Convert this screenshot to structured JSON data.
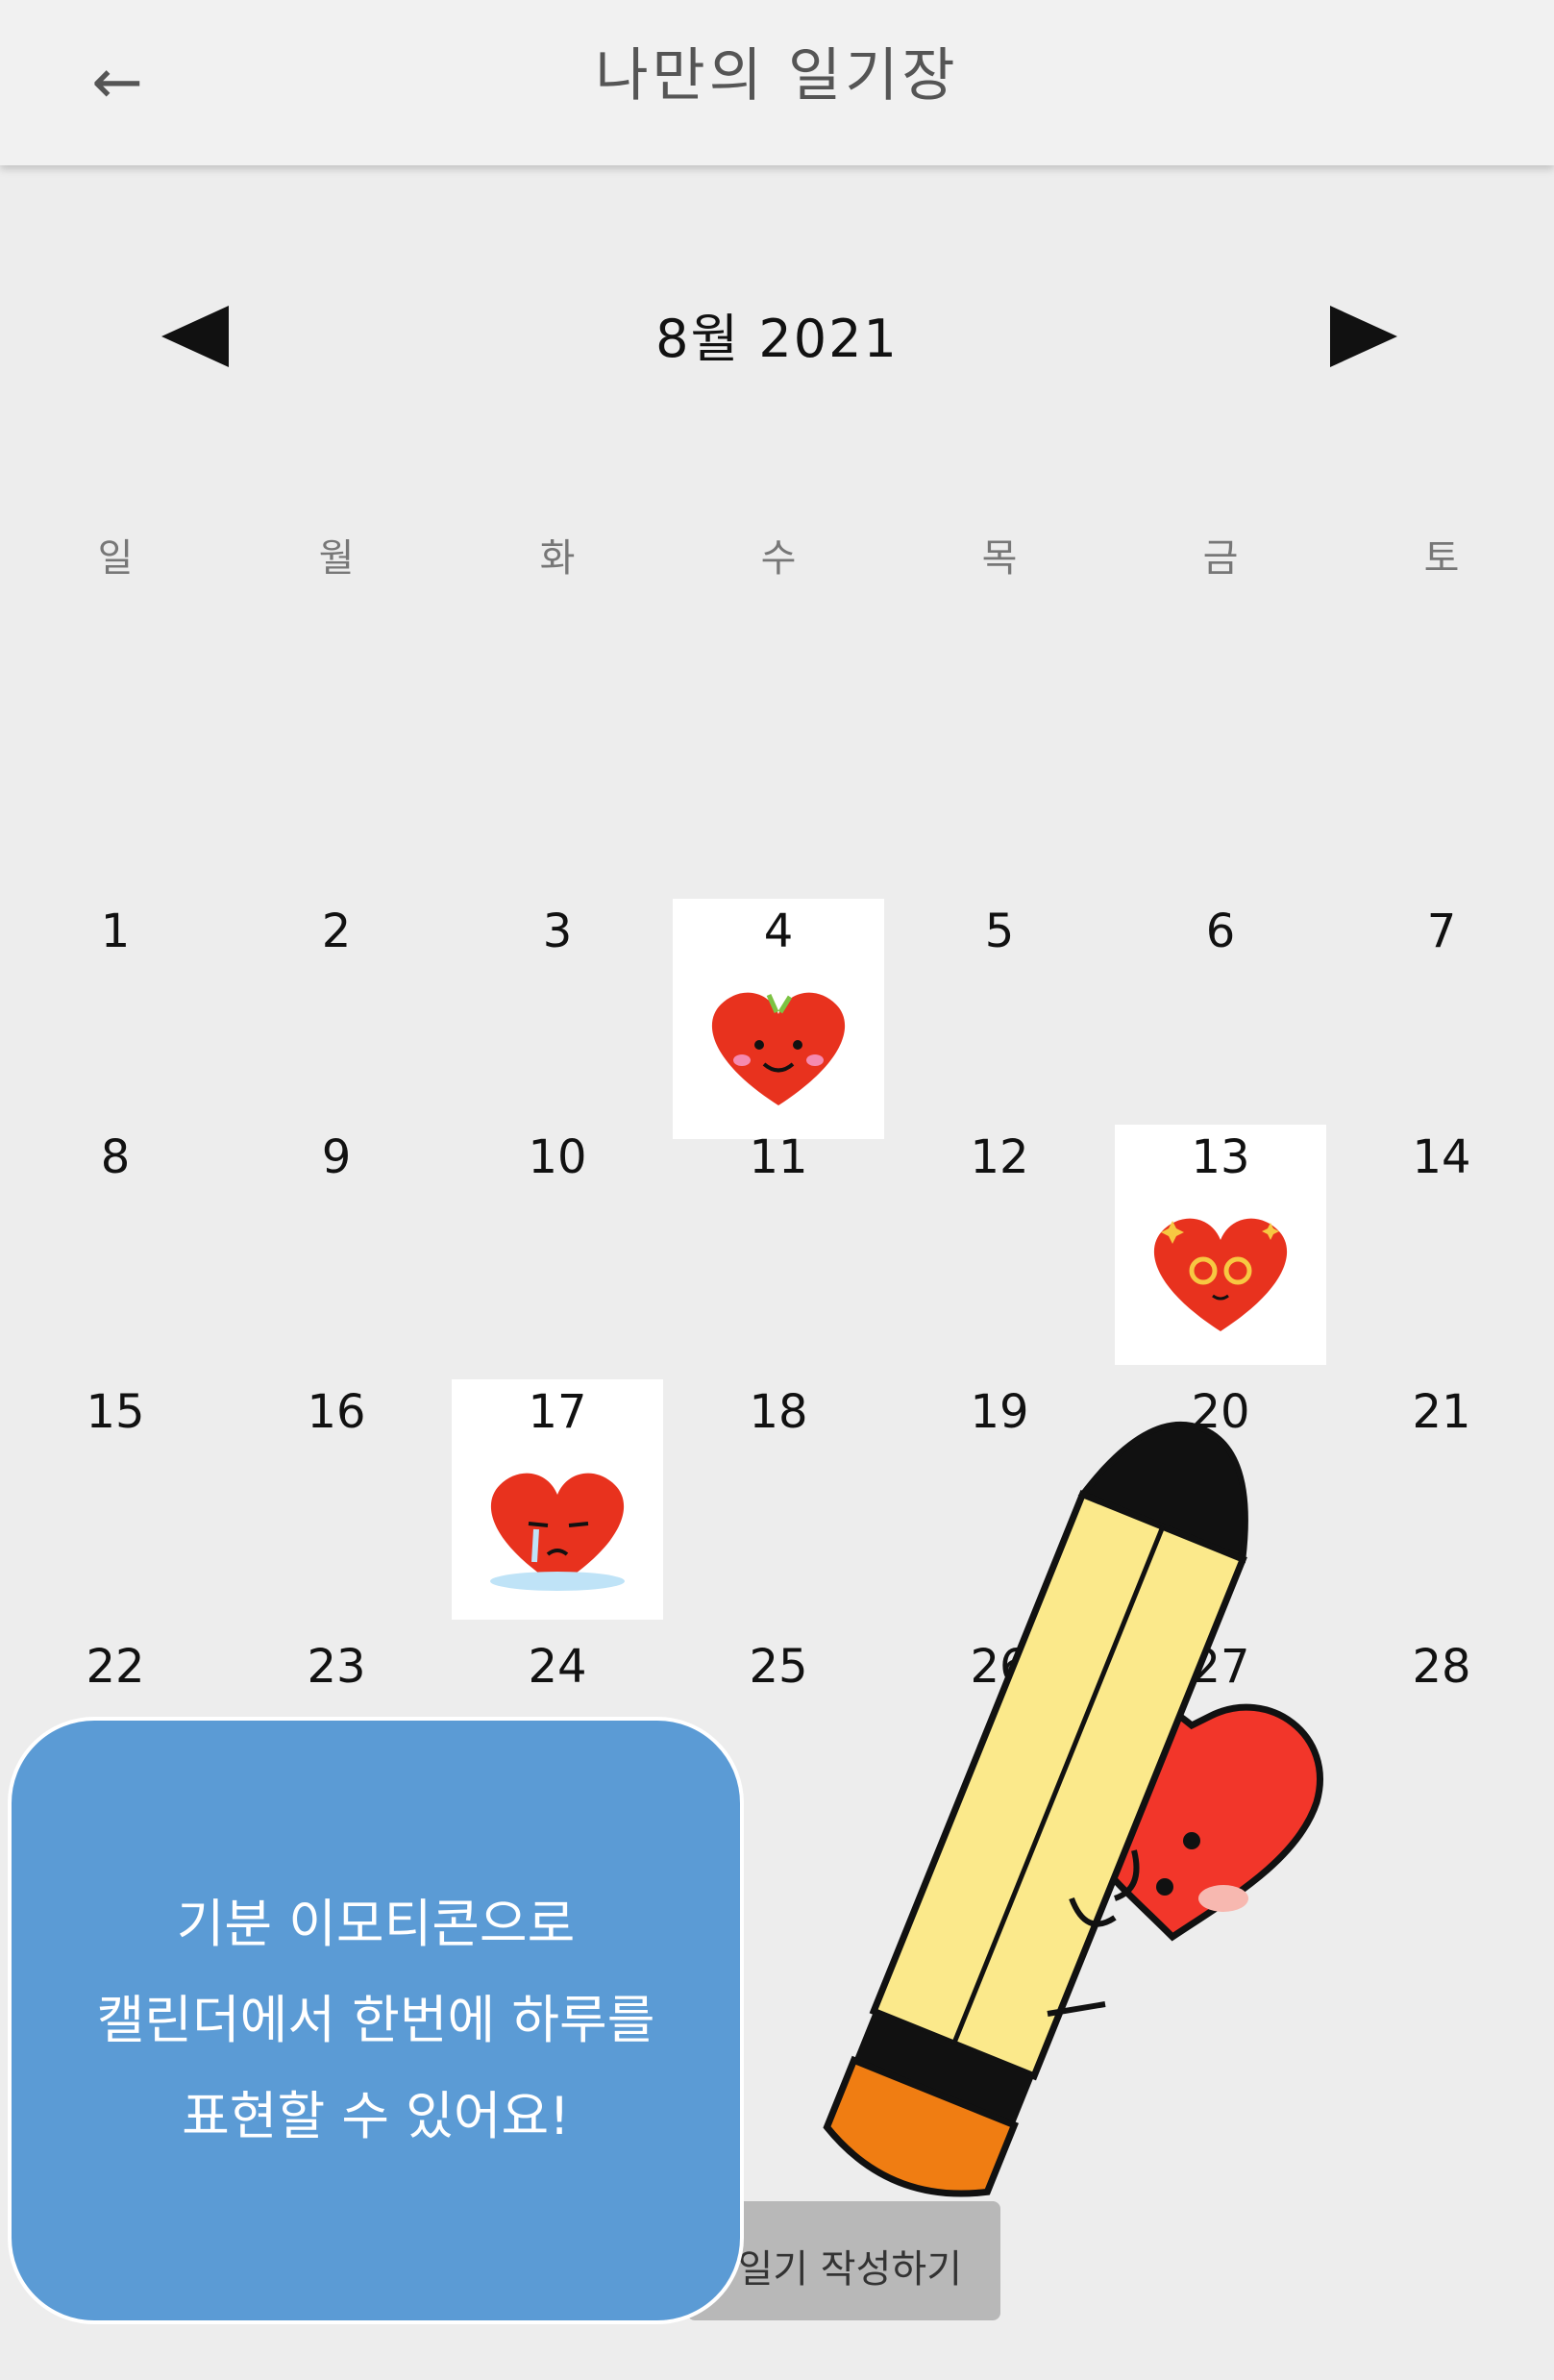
{
  "header": {
    "back_icon": "arrow-left-icon",
    "title": "나만의 일기장"
  },
  "calendar": {
    "month_label": "8월 2021",
    "prev_icon": "triangle-left-icon",
    "next_icon": "triangle-right-icon",
    "weekdays": [
      "일",
      "월",
      "화",
      "수",
      "목",
      "금",
      "토"
    ],
    "days": [
      "1",
      "2",
      "3",
      "4",
      "5",
      "6",
      "7",
      "8",
      "9",
      "10",
      "11",
      "12",
      "13",
      "14",
      "15",
      "16",
      "17",
      "18",
      "19",
      "20",
      "21",
      "22",
      "23",
      "24",
      "25",
      "26",
      "27",
      "28"
    ],
    "moods": {
      "4": "happy-heart",
      "13": "excited-heart",
      "17": "sad-heart"
    }
  },
  "write_button": {
    "label": "일기 작성하기"
  },
  "promo": {
    "lines": [
      "기분 이모티콘으로",
      "캘린더에서 한번에 하루를",
      "표현할 수 있어요!"
    ]
  },
  "colors": {
    "heart": "#e8321e",
    "bubble": "#5b9bd5",
    "pencil_body": "#fbe98b",
    "pencil_tip": "#f07d12"
  }
}
